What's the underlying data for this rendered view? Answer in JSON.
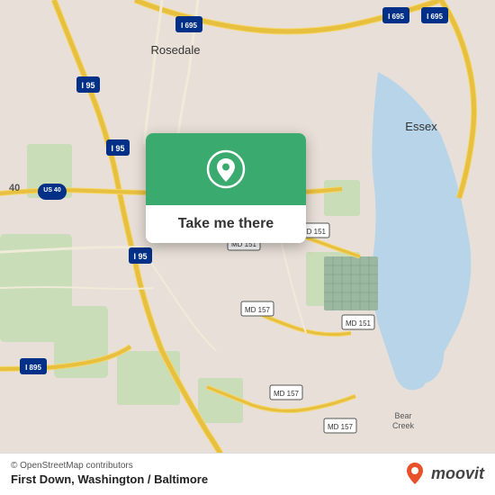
{
  "map": {
    "background_color": "#e8e0d8",
    "attribution": "© OpenStreetMap contributors",
    "location_title": "First Down, Washington / Baltimore"
  },
  "popup": {
    "button_label": "Take me there",
    "pin_color": "#ffffff",
    "background_color": "#3aaa6e"
  },
  "moovit": {
    "logo_text": "moovit"
  }
}
